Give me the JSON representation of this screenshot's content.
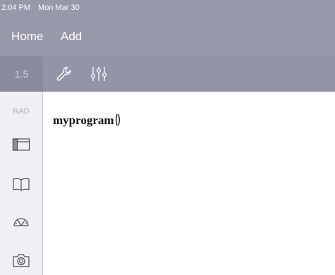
{
  "status_bar": {
    "time": "2:04 PM",
    "date": "Mon Mar 30"
  },
  "menu": {
    "home_label": "Home",
    "add_label": "Add"
  },
  "toolbar": {
    "zoom_value": "1.5",
    "icons": [
      "wrench-icon",
      "sliders-icon"
    ]
  },
  "sidebar": {
    "angle_mode": "RAD",
    "icons": [
      "layout-icon",
      "book-icon",
      "gauge-icon",
      "camera-icon"
    ]
  },
  "editor": {
    "command_text": "myprogram"
  },
  "colors": {
    "header_bg": "#9898ab",
    "toolbar_bg": "#9494a8",
    "zoom_bg": "#8a8a9d",
    "sidebar_bg": "#f0f0f4",
    "icon_stroke": "#4a4a55"
  }
}
